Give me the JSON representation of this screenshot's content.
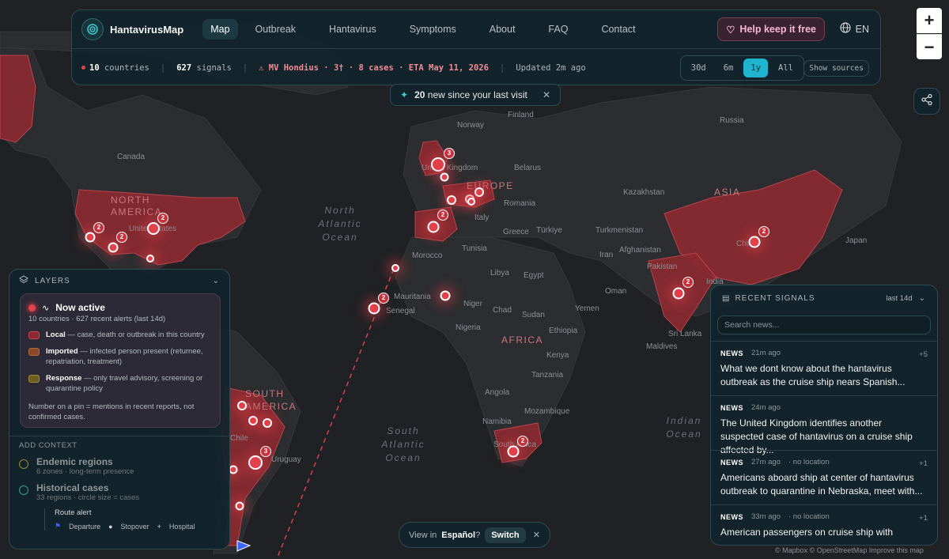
{
  "nav": {
    "brand": "HantavirusMap",
    "items": [
      "Map",
      "Outbreak",
      "Hantavirus",
      "Symptoms",
      "About",
      "FAQ",
      "Contact"
    ],
    "help_label": "Help keep it free",
    "language": "EN"
  },
  "status": {
    "countries": "10",
    "countries_label": "countries",
    "signals": "627",
    "signals_label": "signals",
    "alert": "MV Hondius · 3† · 8 cases · ETA May 11, 2026",
    "updated": "Updated 2m ago",
    "ranges": [
      "30d",
      "6m",
      "1y",
      "All"
    ],
    "selected_range": "1y",
    "sources_label": "Show sources"
  },
  "toast": {
    "count": "20",
    "text": "new since your last visit"
  },
  "map": {
    "geo_labels": [
      "Canada",
      "Norway",
      "Finland",
      "Russia",
      "Belarus",
      "Kazakhstan",
      "Romania",
      "Italy",
      "Greece",
      "Türkiye",
      "Turkmenistan",
      "Afghanistan",
      "Iran",
      "Morocco",
      "Tunisia",
      "Libya",
      "Egypt",
      "Mauritania",
      "Senegal",
      "Niger",
      "Chad",
      "Sudan",
      "Nigeria",
      "Ethiopia",
      "Kenya",
      "Tanzania",
      "Angola",
      "Namibia",
      "Mozambique",
      "Oman",
      "Yemen",
      "Pakistan",
      "Sri Lanka",
      "Maldives",
      "Japan",
      "Chile",
      "Uruguay",
      "United States",
      "United Kingdom",
      "India",
      "China",
      "South Africa"
    ],
    "continents": [
      "NORTH AMERICA",
      "EUROPE",
      "AFRICA",
      "ASIA",
      "SOUTH AMERICA"
    ],
    "oceans": [
      "North Atlantic Ocean",
      "South Atlantic Ocean",
      "Indian Ocean"
    ],
    "pin_counts": [
      "2",
      "2",
      "2",
      "3",
      "2",
      "2",
      "2",
      "2",
      "3",
      "2"
    ]
  },
  "layers": {
    "title": "LAYERS",
    "now_active": "Now active",
    "now_active_sub": "10 countries · 627 recent alerts (last 14d)",
    "legend": [
      {
        "term": "Local",
        "desc": " — case, death or outbreak in this country",
        "color": "#8a2a30"
      },
      {
        "term": "Imported",
        "desc": " — infected person present (returnee, repatriation, treatment)",
        "color": "#8a4a2a"
      },
      {
        "term": "Response",
        "desc": " — only travel advisory, screening or quarantine policy",
        "color": "#7a6a2a"
      }
    ],
    "note": "Number on a pin = mentions in recent reports, not confirmed cases.",
    "add_context": "ADD CONTEXT",
    "endemic_title": "Endemic regions",
    "endemic_sub": "6 zones · long-term presence",
    "historical_title": "Historical cases",
    "historical_sub": "33 regions · circle size = cases",
    "route_alert": "Route alert",
    "route_departure": "Departure",
    "route_stopover": "Stopover",
    "route_hospital": "Hospital"
  },
  "signals": {
    "title": "RECENT SIGNALS",
    "range": "last 14d",
    "search_placeholder": "Search news...",
    "items": [
      {
        "tag": "NEWS",
        "time": "21m ago",
        "loc": "",
        "plus": "+5",
        "title": "What we dont know about the hantavirus outbreak as the cruise ship nears Spanish..."
      },
      {
        "tag": "NEWS",
        "time": "24m ago",
        "loc": "",
        "plus": "",
        "title": "The United Kingdom identifies another suspected case of hantavirus on a cruise ship affected by..."
      },
      {
        "tag": "NEWS",
        "time": "27m ago",
        "loc": "· no location",
        "plus": "+1",
        "title": "Americans aboard ship at center of hantavirus outbreak to quarantine in Nebraska, meet with..."
      },
      {
        "tag": "NEWS",
        "time": "33m ago",
        "loc": "· no location",
        "plus": "+1",
        "title": "American passengers on cruise ship with"
      }
    ]
  },
  "lang_banner": {
    "prefix": "View in",
    "language": "Español",
    "suffix": "?",
    "switch": "Switch"
  },
  "attribution": "© Mapbox © OpenStreetMap  Improve this map"
}
